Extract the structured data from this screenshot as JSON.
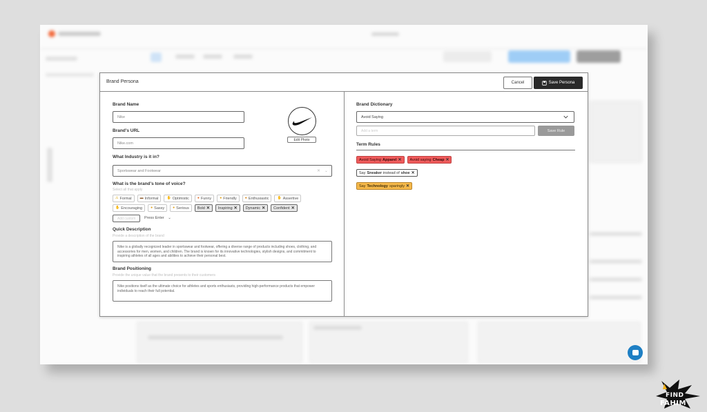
{
  "background": {
    "blurred": true,
    "accent_color": "#f26a3d",
    "primary_button_color": "#9fcdf6"
  },
  "modal": {
    "title": "Brand Persona",
    "cancel_label": "Cancel",
    "save_label": "Save Persona"
  },
  "left": {
    "brand_name_label": "Brand Name",
    "brand_name_value": "Nike",
    "brand_url_label": "Brand's URL",
    "brand_url_value": "Nike.com",
    "edit_photo_label": "Edit Photo",
    "industry_label": "What Industry is it in?",
    "industry_value": "Sportswear and Footwear",
    "tone_label": "What is the brand's tone of voice?",
    "tone_hint": "Select all that apply",
    "tones": [
      {
        "icon": "⚠",
        "label": "Formal",
        "selected": false
      },
      {
        "icon": "▬",
        "label": "Informal",
        "selected": false
      },
      {
        "icon": "✋",
        "label": "Optimistic",
        "selected": false
      },
      {
        "icon": "●",
        "label": "Funny",
        "selected": false
      },
      {
        "icon": "●",
        "label": "Friendly",
        "selected": false
      },
      {
        "icon": "●",
        "label": "Enthusiastic",
        "selected": false
      },
      {
        "icon": "✋",
        "label": "Assertive",
        "selected": false
      },
      {
        "icon": "✋",
        "label": "Encouraging",
        "selected": false
      },
      {
        "icon": "●",
        "label": "Sassy",
        "selected": false
      },
      {
        "icon": "●",
        "label": "Serious",
        "selected": false
      },
      {
        "icon": "",
        "label": "Bold",
        "selected": true
      },
      {
        "icon": "",
        "label": "Inspiring",
        "selected": true
      },
      {
        "icon": "",
        "label": "Dynamic",
        "selected": true
      },
      {
        "icon": "",
        "label": "Confident",
        "selected": true
      }
    ],
    "custom_tone_placeholder": "Add custom",
    "press_enter": "Press Enter",
    "quick_desc_label": "Quick Description",
    "quick_desc_hint": "Provide a description of the brand",
    "quick_desc_value": "Nike is a globally recognized leader in sportswear and footwear, offering a diverse range of products including shoes, clothing, and accessories for men, women, and children. The brand is known for its innovative technologies, stylish designs, and commitment to inspiring athletes of all ages and abilities to achieve their personal best.",
    "positioning_label": "Brand Positioning",
    "positioning_hint": "Provide the unique value that the brand presents to their customers",
    "positioning_value": "Nike positions itself as the ultimate choice for athletes and sports enthusiasts, providing high-performance products that empower individuals to reach their full potential."
  },
  "right": {
    "dictionary_label": "Brand Dictionary",
    "dictionary_select": "Avoid Saying",
    "new_term_placeholder": "Add a term",
    "save_rule_label": "Save Rule",
    "term_rules_label": "Term Rules",
    "rules": [
      [
        {
          "style": "red",
          "pre": "Avoid Saying",
          "term": "Apparel",
          "post": ""
        },
        {
          "style": "red",
          "pre": "Avoid saying",
          "term": "Cheap",
          "post": ""
        }
      ],
      [
        {
          "style": "plain",
          "pre": "Say",
          "term": "Sneaker",
          "post": "instead of",
          "term2": "shoe"
        }
      ],
      [
        {
          "style": "yellow",
          "pre": "Say",
          "term": "Technology",
          "post": "sparingly"
        }
      ]
    ]
  },
  "brand_logo": "nike-swoosh-icon",
  "watermark": {
    "line1": "FIND",
    "line2": "FAHIM"
  }
}
